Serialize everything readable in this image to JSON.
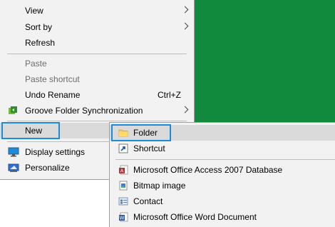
{
  "context_menu": {
    "view_label": "View",
    "sort_by_label": "Sort by",
    "refresh_label": "Refresh",
    "paste_label": "Paste",
    "paste_shortcut_label": "Paste shortcut",
    "undo_rename_label": "Undo Rename",
    "undo_rename_shortcut": "Ctrl+Z",
    "groove_label": "Groove Folder Synchronization",
    "new_label": "New",
    "display_settings_label": "Display settings",
    "personalize_label": "Personalize"
  },
  "new_submenu": {
    "items": [
      {
        "label": "Folder",
        "icon": "folder-icon"
      },
      {
        "label": "Shortcut",
        "icon": "shortcut-icon"
      },
      {
        "label": "Microsoft Office Access 2007 Database",
        "icon": "access-database-icon"
      },
      {
        "label": "Bitmap image",
        "icon": "bitmap-image-icon"
      },
      {
        "label": "Contact",
        "icon": "contact-icon"
      },
      {
        "label": "Microsoft Office Word Document",
        "icon": "word-document-icon"
      }
    ]
  },
  "colors": {
    "desktop": "#128a3e",
    "menu_bg": "#f2f2f2",
    "highlight_box": "#1a8cd8"
  }
}
